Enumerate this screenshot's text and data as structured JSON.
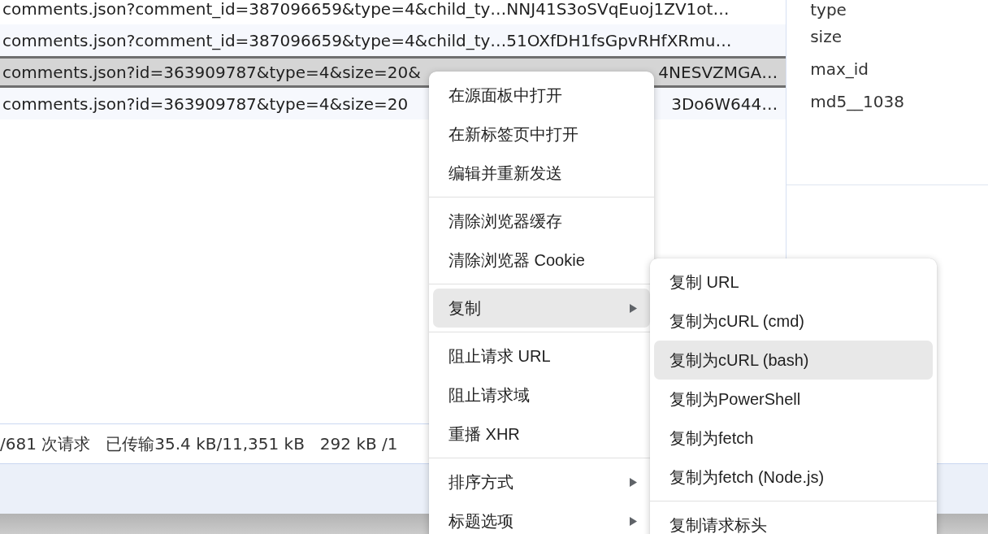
{
  "requests": [
    {
      "name": "comments.json?comment_id=387096659&type=4&child_ty…NNJ41S3oSVqEuoj1ZV1ot…",
      "selected": false
    },
    {
      "name": "comments.json?comment_id=387096659&type=4&child_ty…51OXfDH1fsGpvRHfXRmu…",
      "selected": false
    },
    {
      "name": "comments.json?id=363909787&type=4&size=20&",
      "name_end": "4NESVZMGA…",
      "selected": true
    },
    {
      "name": "comments.json?id=363909787&type=4&size=20",
      "name_end": "3Do6W644…",
      "selected": false
    }
  ],
  "payload": {
    "params": [
      "type",
      "size",
      "max_id",
      "md5__1038"
    ]
  },
  "status_bar": {
    "items": [
      "/681 次请求",
      "已传输35.4 kB/11,351 kB",
      "292 kB /1"
    ]
  },
  "context_menu": {
    "items": [
      {
        "kind": "item",
        "label": "在源面板中打开",
        "has_submenu": false,
        "highlighted": false
      },
      {
        "kind": "item",
        "label": "在新标签页中打开",
        "has_submenu": false,
        "highlighted": false
      },
      {
        "kind": "item",
        "label": "编辑并重新发送",
        "has_submenu": false,
        "highlighted": false
      },
      {
        "kind": "separator"
      },
      {
        "kind": "item",
        "label": "清除浏览器缓存",
        "has_submenu": false,
        "highlighted": false
      },
      {
        "kind": "item",
        "label": "清除浏览器 Cookie",
        "has_submenu": false,
        "highlighted": false
      },
      {
        "kind": "separator"
      },
      {
        "kind": "item",
        "label": "复制",
        "has_submenu": true,
        "highlighted": true
      },
      {
        "kind": "separator"
      },
      {
        "kind": "item",
        "label": "阻止请求 URL",
        "has_submenu": false,
        "highlighted": false
      },
      {
        "kind": "item",
        "label": "阻止请求域",
        "has_submenu": false,
        "highlighted": false
      },
      {
        "kind": "item",
        "label": "重播 XHR",
        "has_submenu": false,
        "highlighted": false
      },
      {
        "kind": "separator"
      },
      {
        "kind": "item",
        "label": "排序方式",
        "has_submenu": true,
        "highlighted": false
      },
      {
        "kind": "item",
        "label": "标题选项",
        "has_submenu": true,
        "highlighted": false
      }
    ]
  },
  "submenu": {
    "items": [
      {
        "kind": "item",
        "label": "复制 URL",
        "highlighted": false
      },
      {
        "kind": "item",
        "label": "复制为cURL (cmd)",
        "highlighted": false
      },
      {
        "kind": "item",
        "label": "复制为cURL (bash)",
        "highlighted": true
      },
      {
        "kind": "item",
        "label": "复制为PowerShell",
        "highlighted": false
      },
      {
        "kind": "item",
        "label": "复制为fetch",
        "highlighted": false
      },
      {
        "kind": "item",
        "label": "复制为fetch (Node.js)",
        "highlighted": false
      },
      {
        "kind": "separator"
      },
      {
        "kind": "item",
        "label": "复制请求标头",
        "highlighted": false
      }
    ]
  }
}
